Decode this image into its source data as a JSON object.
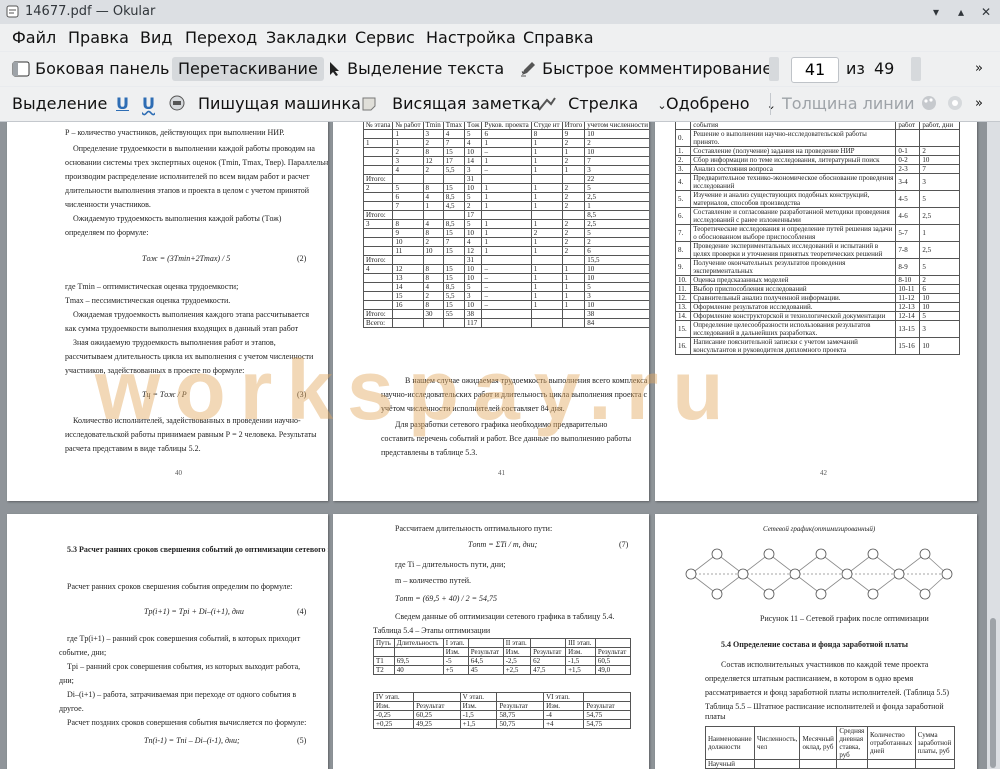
{
  "window": {
    "title": "14677.pdf — Okular"
  },
  "menu": [
    "Файл",
    "Правка",
    "Вид",
    "Переход",
    "Закладки",
    "Сервис",
    "Настройка",
    "Справка"
  ],
  "toolbar1": {
    "sidebar": "Боковая панель",
    "browse": "Перетаскивание",
    "text_select": "Выделение текста",
    "quick_comment": "Быстрое комментирование",
    "page_current": "41",
    "page_of": "из",
    "page_total": "49"
  },
  "toolbar2": {
    "highlight": "Выделение",
    "typewriter": "Пишущая машинка",
    "popup_note": "Висящая заметка",
    "arrow": "Стрелка",
    "approved": "Одобрено",
    "line_width": "Толщина линии"
  },
  "watermark": "workspay.ru",
  "pages": {
    "p40": {
      "number": "40",
      "lines": [
        "Р – количество участников, действующих при выполнении НИР.",
        "Определение трудоемкости в выполнении каждой работы проводим на",
        "основании системы трех экспертных оценок (Tmin, Tmax, Tвер). Параллельно",
        "производим распределение исполнителей по всем видам работ и расчет",
        "длительности выполнения этапов и проекта в целом с учетом принятой",
        "численности участников.",
        "Ожидаемую трудоемкость выполнения каждой работы (Tож)",
        "определяем по формуле:",
        "где Tmin – оптимистическая оценка трудоемкости;",
        "Tmax – пессимистическая оценка трудоемкости.",
        "Ожидаемая трудоемкость выполнения каждого этапа рассчитывается",
        "как сумма трудоемкости выполнения входящих в данный этап работ",
        "Зная ожидаемую трудоемкость выполнения работ и этапов,",
        "рассчитываем длительность цикла их выполнения с учетом численности",
        "участников, задействованных в проекте по формуле:",
        "Количество исполнителей, задействованных в проведении научно-",
        "исследовательской работы принимаем равным Р = 2 человека. Результаты",
        "расчета представим в виде таблицы 5.2."
      ],
      "formula1": "Tож = (3Tmin+2Tmax) / 5",
      "formula1_no": "(2)",
      "formula2": "Tц = Tож / P",
      "formula2_no": "(3)"
    },
    "p41": {
      "number": "41",
      "headers": [
        "№ этапа",
        "№ работ",
        "Tmin",
        "Tmax",
        "Tож",
        "Руков. проекта",
        "Студе нт",
        "Итого",
        "учетом численности работников, дней"
      ],
      "rows": [
        [
          "",
          "1",
          "3",
          "4",
          "5",
          "6",
          "8",
          "9",
          "10"
        ],
        [
          "1",
          "1",
          "2",
          "7",
          "4",
          "1",
          "1",
          "2",
          "2"
        ],
        [
          "",
          "2",
          "8",
          "15",
          "10",
          "–",
          "1",
          "1",
          "10"
        ],
        [
          "",
          "3",
          "12",
          "17",
          "14",
          "1",
          "1",
          "2",
          "7"
        ],
        [
          "",
          "4",
          "2",
          "5,5",
          "3",
          "–",
          "1",
          "1",
          "3"
        ],
        [
          "Итого:",
          "",
          "",
          "",
          "31",
          "",
          "",
          "",
          "22"
        ],
        [
          "2",
          "5",
          "8",
          "15",
          "10",
          "1",
          "1",
          "2",
          "5"
        ],
        [
          "",
          "6",
          "4",
          "8,5",
          "5",
          "1",
          "1",
          "2",
          "2,5"
        ],
        [
          "",
          "7",
          "1",
          "4,5",
          "2",
          "1",
          "1",
          "2",
          "1"
        ],
        [
          "Итого:",
          "",
          "",
          "",
          "17",
          "",
          "",
          "",
          "8,5"
        ],
        [
          "3",
          "8",
          "4",
          "8,5",
          "5",
          "1",
          "1",
          "2",
          "2,5"
        ],
        [
          "",
          "9",
          "8",
          "15",
          "10",
          "1",
          "2",
          "2",
          "5"
        ],
        [
          "",
          "10",
          "2",
          "7",
          "4",
          "1",
          "1",
          "2",
          "2"
        ],
        [
          "",
          "11",
          "10",
          "15",
          "12",
          "1",
          "1",
          "2",
          "6"
        ],
        [
          "Итого:",
          "",
          "",
          "",
          "31",
          "",
          "",
          "",
          "15,5"
        ],
        [
          "4",
          "12",
          "8",
          "15",
          "10",
          "–",
          "1",
          "1",
          "10"
        ],
        [
          "",
          "13",
          "8",
          "15",
          "10",
          "–",
          "1",
          "1",
          "10"
        ],
        [
          "",
          "14",
          "4",
          "8,5",
          "5",
          "–",
          "1",
          "1",
          "5"
        ],
        [
          "",
          "15",
          "2",
          "5,5",
          "3",
          "–",
          "1",
          "1",
          "3"
        ],
        [
          "",
          "16",
          "8",
          "15",
          "10",
          "–",
          "1",
          "1",
          "10"
        ],
        [
          "Итого:",
          "",
          "30",
          "55",
          "38",
          "",
          "",
          "",
          "38"
        ],
        [
          "Всего:",
          "",
          "",
          "",
          "117",
          "",
          "",
          "",
          "84"
        ]
      ],
      "lines": [
        "В нашем случае ожидаемая трудоемкость выполнения всего комплекса",
        "научно-исследовательских работ и длительность цикла выполнения проекта с",
        "учётом численности исполнителей составляет 84 дня.",
        "Для разработки сетевого графика необходимо предварительно",
        "составить перечень событий и работ. Все данные по выполнению работы",
        "представлены в таблице 5.3."
      ]
    },
    "p42": {
      "number": "42",
      "top_headers": [
        "события",
        "работ",
        "работ, дни"
      ],
      "rows": [
        [
          "0.",
          "Решение о выполнении научно-исследовательской работы принято.",
          "",
          ""
        ],
        [
          "1.",
          "Составление (получение) задания на проведение НИР",
          "0-1",
          "2"
        ],
        [
          "2.",
          "Сбор информации по теме исследования, литературный поиск",
          "0-2",
          "10"
        ],
        [
          "3.",
          "Анализ состояния вопроса",
          "2-3",
          "7"
        ],
        [
          "4.",
          "Предварительное технико-экономическое обоснование проведения исследований",
          "3-4",
          "3"
        ],
        [
          "5.",
          "Изучение и анализ существующих подобных конструкций, материалов, способов производства",
          "4-5",
          "5"
        ],
        [
          "6.",
          "Составление и согласование разработанной методики проведения исследований с ранее изложенными",
          "4-6",
          "2,5"
        ],
        [
          "7.",
          "Теоретические исследования и определение путей решения задачи о обоснованном выборе приспособления",
          "5-7",
          "1"
        ],
        [
          "8.",
          "Проведение экспериментальных исследований и испытаний в целях проверки и уточнения принятых теоретических решений",
          "7-8",
          "2,5"
        ],
        [
          "9.",
          "Получение окончательных результатов проведения экспериментальных",
          "8-9",
          "5"
        ],
        [
          "10.",
          "Оценка предсказанных моделей",
          "8-10",
          "2"
        ],
        [
          "11.",
          "Выбор приспособления исследований",
          "10-11",
          "6"
        ],
        [
          "12.",
          "Сравнительный анализ полученной информации.",
          "11-12",
          "10"
        ],
        [
          "13.",
          "Оформление результатов исследований.",
          "12-13",
          "10"
        ],
        [
          "14.",
          "Оформление конструкторской и технологической документации",
          "12-14",
          "5"
        ],
        [
          "15.",
          "Определение целесообразности использования результатов исследований в дальнейших разработках.",
          "13-15",
          "3"
        ],
        [
          "16.",
          "Написание пояснительной записки с учетом замечаний консультантов и руководителя дипломного проекта",
          "15-16",
          "10"
        ]
      ]
    },
    "p43": {
      "title": "5.3 Расчет ранних сроков свершения событий до оптимизации сетевого графика",
      "lines": [
        "Расчет ранних сроков свершения события определим по формуле:",
        "где Tp(i+1) – ранний срок совершения событий, в которых приходит",
        "событие, дни;",
        "Tpi – ранний срок совершения события, из которых выходит работа,",
        "дни;",
        "Di–(i+1) – работа, затрачиваемая при переходе от одного события в",
        "другое.",
        "Расчет поздних сроков совершения события вычисляется по формуле:"
      ],
      "formula1": "Tp(i+1) = Tpi + Di–(i+1), дни",
      "formula1_no": "(4)",
      "formula2": "Tп(i-1) = Tпi – Di–(i-1), дни;",
      "formula2_no": "(5)"
    },
    "p44": {
      "lines": [
        "Рассчитаем длительность оптимального пути:",
        "где Ti – длительность пути, дни;",
        "m – количество путей.",
        "Сведем данные об оптимизации сетевого графика в таблицу 5.4.",
        "Таблица 5.4 – Этапы оптимизации"
      ],
      "formula1": "Tопт = ΣTi / m, дни;",
      "formula1_no": "(7)",
      "formula2": "Tопт = (69,5 + 40) / 2 = 54,75",
      "t1_headers": [
        "Путь",
        "Длительность",
        "I этап.",
        "",
        "II этап.",
        "",
        "III этап.",
        ""
      ],
      "t1_sub": [
        "",
        "",
        "Изм.",
        "Результат",
        "Изм.",
        "Результат",
        "Изм.",
        "Результат"
      ],
      "t1_rows": [
        [
          "T1",
          "69,5",
          "-5",
          "64,5",
          "-2,5",
          "62",
          "-1,5",
          "60,5"
        ],
        [
          "T2",
          "40",
          "+5",
          "45",
          "+2,5",
          "47,5",
          "+1,5",
          "49,0"
        ]
      ],
      "t2_headers": [
        "IV этап.",
        "",
        "V этап.",
        "",
        "VI этап.",
        ""
      ],
      "t2_sub": [
        "Изм.",
        "Результат",
        "Изм.",
        "Результат",
        "Изм.",
        "Результат"
      ],
      "t2_rows": [
        [
          "-0,25",
          "60,25",
          "-1,5",
          "58,75",
          "-4",
          "54,75"
        ],
        [
          "+0,25",
          "49,25",
          "+1,5",
          "50,75",
          "+4",
          "54,75"
        ]
      ]
    },
    "p45": {
      "diagram_caption": "Сетевой график(оптимизированный)",
      "figure_caption": "Рисунок 11 – Сетевой график после оптимизации",
      "section": "5.4 Определение состава и фонда заработной платы",
      "lines": [
        "Состав исполнительных участников по каждой теме проекта",
        "определяется штатным расписанием, в котором в одно время",
        "рассматривается и фонд заработной платы исполнителей. (Таблица 5.5)",
        "Таблица 5.5 – Штатное расписание исполнителей и фонда заработной",
        "платы"
      ],
      "headers": [
        "Наименование должности",
        "Численность, чел",
        "Месячный оклад, руб",
        "Средняя дневная ставка, руб",
        "Количество отработанных дней",
        "Сумма заработной платы, руб"
      ],
      "row": [
        "Научный",
        "",
        "",
        "",
        "",
        ""
      ]
    }
  },
  "colors": {
    "accent": "#3daee9",
    "watermark": "#e2a860",
    "viewport": "#8f9499"
  }
}
